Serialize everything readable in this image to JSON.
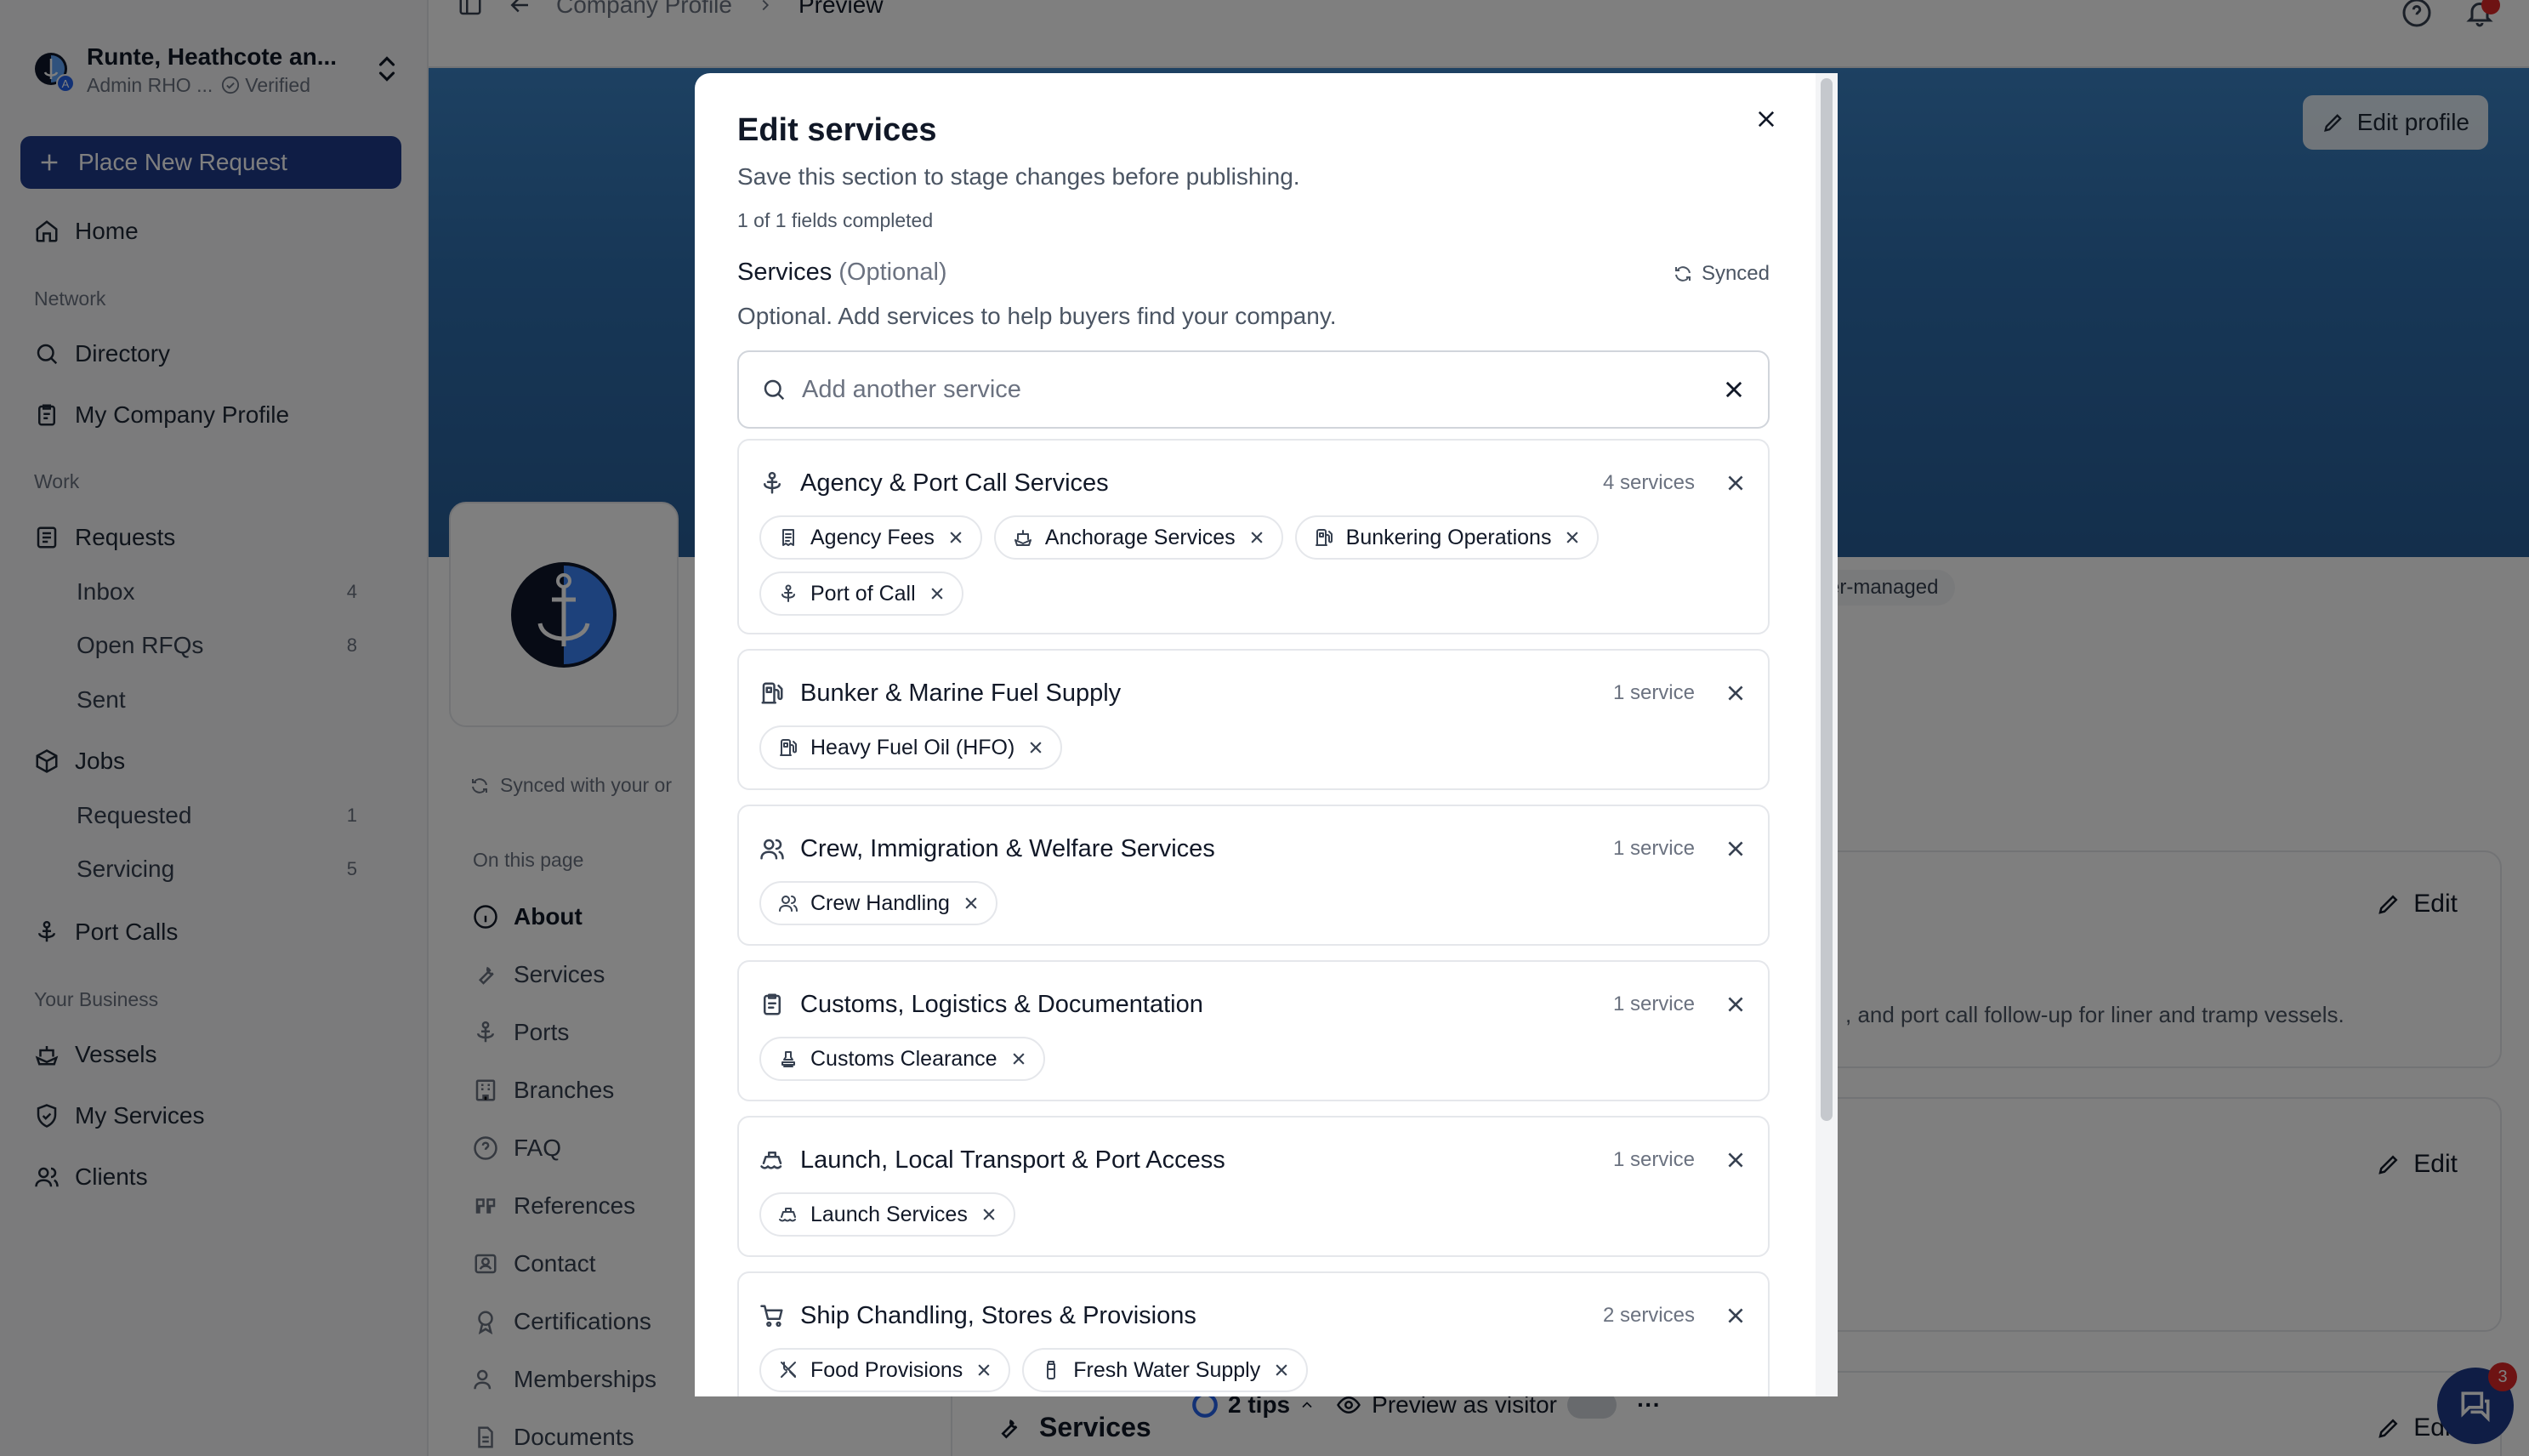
{
  "sidebar": {
    "org_name": "Runte, Heathcote an...",
    "org_role": "Admin RHO ...",
    "org_verified": "Verified",
    "org_mini": "A",
    "new_request": "Place New Request",
    "home": "Home",
    "group_network": "Network",
    "directory": "Directory",
    "my_company_profile": "My Company Profile",
    "group_work": "Work",
    "requests": "Requests",
    "inbox": "Inbox",
    "inbox_count": "4",
    "open_rfqs": "Open RFQs",
    "open_rfqs_count": "8",
    "sent": "Sent",
    "jobs": "Jobs",
    "requested": "Requested",
    "requested_count": "1",
    "servicing": "Servicing",
    "servicing_count": "5",
    "port_calls": "Port Calls",
    "group_business": "Your Business",
    "vessels": "Vessels",
    "my_services": "My Services",
    "clients": "Clients"
  },
  "topbar": {
    "crumb_parent": "Company Profile",
    "crumb_current": "Preview"
  },
  "profile": {
    "edit_profile": "Edit profile",
    "managed_badge": "er-managed",
    "synced_note": "Synced with your or",
    "on_this_page": "On this page",
    "sections": [
      "About",
      "Services",
      "Ports",
      "Branches",
      "FAQ",
      "References",
      "Contact",
      "Certifications",
      "Memberships",
      "Documents"
    ],
    "edit_label": "Edit",
    "about_text": ", and port call follow-up for liner and tramp vessels.",
    "services_title": "Services",
    "tips": "2 tips",
    "preview_visitor": "Preview as visitor",
    "more": "···",
    "chat_badge": "3"
  },
  "modal": {
    "title": "Edit services",
    "subtitle": "Save this section to stage changes before publishing.",
    "progress": "1 of 1 fields completed",
    "section_label": "Services",
    "section_optional": "(Optional)",
    "synced": "Synced",
    "help": "Optional. Add services to help buyers find your company.",
    "search_placeholder": "Add another service",
    "categories": [
      {
        "name": "Agency & Port Call Services",
        "count": "4 services",
        "icon": "anchor-icon",
        "chips": [
          {
            "label": "Agency Fees",
            "icon": "receipt-icon"
          },
          {
            "label": "Anchorage Services",
            "icon": "ship-icon"
          },
          {
            "label": "Bunkering Operations",
            "icon": "fuel-icon"
          },
          {
            "label": "Port of Call",
            "icon": "anchor-icon"
          }
        ]
      },
      {
        "name": "Bunker & Marine Fuel Supply",
        "count": "1 service",
        "icon": "fuel-icon",
        "chips": [
          {
            "label": "Heavy Fuel Oil (HFO)",
            "icon": "fuel-icon"
          }
        ]
      },
      {
        "name": "Crew, Immigration & Welfare Services",
        "count": "1 service",
        "icon": "users-icon",
        "chips": [
          {
            "label": "Crew Handling",
            "icon": "users-icon"
          }
        ]
      },
      {
        "name": "Customs, Logistics & Documentation",
        "count": "1 service",
        "icon": "clipboard-icon",
        "chips": [
          {
            "label": "Customs Clearance",
            "icon": "stamp-icon"
          }
        ]
      },
      {
        "name": "Launch, Local Transport & Port Access",
        "count": "1 service",
        "icon": "boat-icon",
        "chips": [
          {
            "label": "Launch Services",
            "icon": "boat-icon"
          }
        ]
      },
      {
        "name": "Ship Chandling, Stores & Provisions",
        "count": "2 services",
        "icon": "cart-icon",
        "chips": [
          {
            "label": "Food Provisions",
            "icon": "utensils-icon"
          },
          {
            "label": "Fresh Water Supply",
            "icon": "bottle-icon"
          }
        ]
      }
    ]
  }
}
